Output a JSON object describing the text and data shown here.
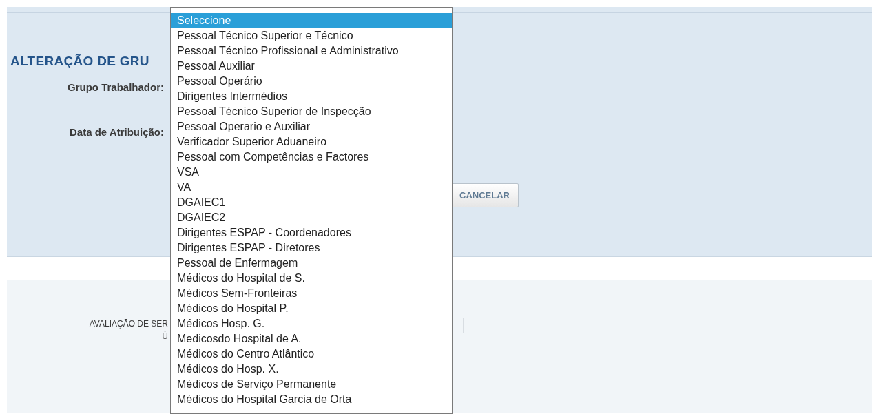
{
  "page": {
    "title": "ALTERAÇÃO DE GRU",
    "fields": [
      {
        "label": "Grupo Trabalhador:"
      },
      {
        "label": "Data de Atribuição:"
      }
    ],
    "buttons": [
      "CANCELAR"
    ]
  },
  "footer": {
    "lines": [
      "AVALIAÇÃO DE SER",
      "Ú"
    ]
  },
  "dropdown": {
    "options": [
      {
        "label": "Seleccione",
        "selected": true
      },
      {
        "label": "Pessoal Técnico Superior e Técnico",
        "selected": false
      },
      {
        "label": "Pessoal Técnico Profissional e Administrativo",
        "selected": false
      },
      {
        "label": "Pessoal Auxiliar",
        "selected": false
      },
      {
        "label": "Pessoal Operário",
        "selected": false
      },
      {
        "label": "Dirigentes Intermédios",
        "selected": false
      },
      {
        "label": "Pessoal Técnico Superior de Inspecção",
        "selected": false
      },
      {
        "label": "Pessoal Operario e Auxiliar",
        "selected": false
      },
      {
        "label": "Verificador Superior Aduaneiro",
        "selected": false
      },
      {
        "label": "Pessoal com Competências e Factores",
        "selected": false
      },
      {
        "label": "VSA",
        "selected": false
      },
      {
        "label": "VA",
        "selected": false
      },
      {
        "label": "DGAIEC1",
        "selected": false
      },
      {
        "label": "DGAIEC2",
        "selected": false
      },
      {
        "label": "Dirigentes ESPAP - Coordenadores",
        "selected": false
      },
      {
        "label": "Dirigentes ESPAP - Diretores",
        "selected": false
      },
      {
        "label": "Pessoal de Enfermagem",
        "selected": false
      },
      {
        "label": "Médicos do Hospital de S.",
        "selected": false
      },
      {
        "label": "Médicos Sem-Fronteiras",
        "selected": false
      },
      {
        "label": "Médicos do Hospital P.",
        "selected": false
      },
      {
        "label": "Médicos Hosp. G.",
        "selected": false
      },
      {
        "label": "Medicosdo Hospital de A.",
        "selected": false
      },
      {
        "label": "Médicos do Centro Atlântico",
        "selected": false
      },
      {
        "label": "Médicos do Hosp. X.",
        "selected": false
      },
      {
        "label": "Médicos de Serviço Permanente",
        "selected": false
      },
      {
        "label": "Médicos do Hospital Garcia de Orta",
        "selected": false
      }
    ]
  }
}
